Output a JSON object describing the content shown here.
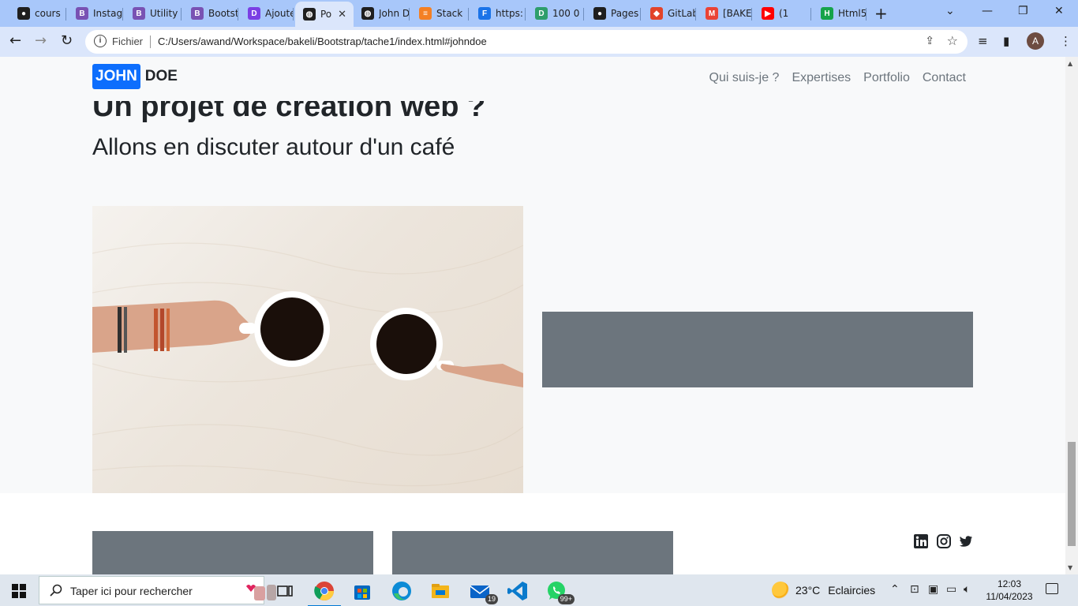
{
  "browser": {
    "tabs": [
      {
        "title": "cours",
        "icon": "github-icon",
        "color": "#1f1f1f"
      },
      {
        "title": "Instag",
        "icon": "bootstrap-icon",
        "color": "#7952b3"
      },
      {
        "title": "Utility",
        "icon": "bootstrap-icon",
        "color": "#7952b3"
      },
      {
        "title": "Bootst",
        "icon": "bootstrap-icon",
        "color": "#7952b3"
      },
      {
        "title": "Ajoute",
        "icon": "dev-icon",
        "color": "#7b3fe4"
      },
      {
        "title": "Po",
        "icon": "globe-icon",
        "color": "#1f1f1f",
        "active": true
      },
      {
        "title": "John D",
        "icon": "globe-icon",
        "color": "#1f1f1f"
      },
      {
        "title": "Stack",
        "icon": "stackoverflow-icon",
        "color": "#f48024"
      },
      {
        "title": "https:",
        "icon": "forms-icon",
        "color": "#1a73e8"
      },
      {
        "title": "100 0",
        "icon": "dev-icon",
        "color": "#2e9e6b"
      },
      {
        "title": "Pages",
        "icon": "github-icon",
        "color": "#1f1f1f"
      },
      {
        "title": "GitLab",
        "icon": "gitlab-icon",
        "color": "#e24329"
      },
      {
        "title": "[BAKE",
        "icon": "gmail-icon",
        "color": "#ea4335"
      },
      {
        "title": "(1",
        "icon": "youtube-icon",
        "color": "#ff0000"
      },
      {
        "title": "Html5",
        "icon": "html5-icon",
        "color": "#16a34a"
      }
    ],
    "address": {
      "scheme_label": "Fichier",
      "url": "C:/Users/awand/Workspace/bakeli/Bootstrap/tache1/index.html#johndoe"
    },
    "profile_initial": "A"
  },
  "page": {
    "brand": {
      "part1": "JOHN",
      "part2": "DOE"
    },
    "nav": [
      "Qui suis-je ?",
      "Expertises",
      "Portfolio",
      "Contact"
    ],
    "heading": "Un projet de création web ?",
    "subheading": "Allons en discuter autour d'un café",
    "colors": {
      "primary": "#0d6efd",
      "secondary": "#6c757d",
      "light": "#f8f9fa",
      "dark": "#212529"
    },
    "social": [
      "linkedin-icon",
      "instagram-icon",
      "twitter-icon"
    ]
  },
  "taskbar": {
    "search_placeholder": "Taper ici pour rechercher",
    "mail_badge": "19",
    "whatsapp_badge": "99+",
    "weather": {
      "temp": "23°C",
      "condition": "Eclaircies"
    },
    "time": "12:03",
    "date": "11/04/2023"
  }
}
